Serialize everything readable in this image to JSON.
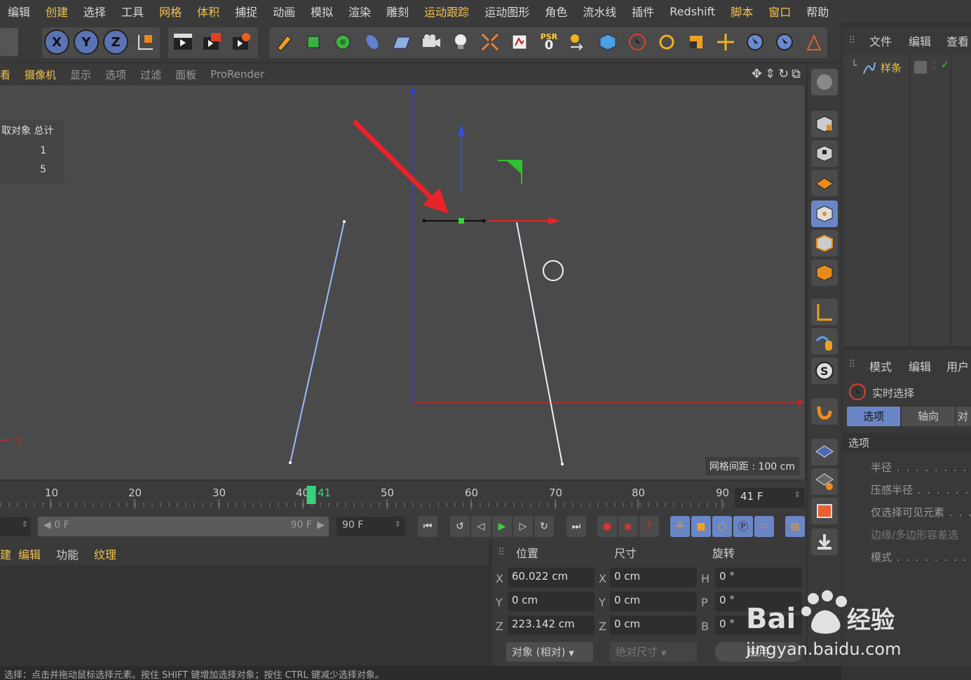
{
  "menubar": [
    "编辑",
    "创建",
    "选择",
    "工具",
    "网格",
    "体积",
    "捕捉",
    "动画",
    "模拟",
    "渲染",
    "雕刻",
    "运动跟踪",
    "运动图形",
    "角色",
    "流水线",
    "插件",
    "Redshift",
    "脚本",
    "窗口",
    "帮助"
  ],
  "toolbar": {
    "psr_label": "PSR",
    "psr_value": "0"
  },
  "viewport_menu": [
    "看",
    "摄像机",
    "显示",
    "选项",
    "过滤",
    "面板",
    "ProRender"
  ],
  "stats": {
    "header": "取对象 总计",
    "values": [
      "1",
      "5"
    ]
  },
  "viewport": {
    "axis_x_label": "X",
    "grid_info": "网格间距 : 100 cm"
  },
  "object_manager": {
    "tabs": [
      "文件",
      "编辑",
      "查看"
    ],
    "object_name": "样条"
  },
  "attribute_manager": {
    "tabs": [
      "模式",
      "编辑",
      "用户"
    ],
    "tool_name": "实时选择",
    "subtabs": [
      "选项",
      "轴向",
      "对"
    ],
    "section": "选项",
    "fields": [
      "半径",
      "压感半径",
      "仅选择可见元素",
      "边缘/多边形容差选",
      "模式"
    ]
  },
  "timeline": {
    "ticks": [
      "10",
      "20",
      "30",
      "40",
      "50",
      "60",
      "70",
      "80",
      "90"
    ],
    "current_marker": "41",
    "current_frame": "41 F",
    "current_frame_value": 41
  },
  "transport": {
    "start_field": "0 F",
    "range_start": "0 F",
    "range_end": "90 F",
    "end_field": "90 F"
  },
  "material_manager": {
    "menu": [
      "建",
      "编辑",
      "功能",
      "纹理"
    ]
  },
  "coordinates": {
    "headers": [
      "位置",
      "尺寸",
      "旋转"
    ],
    "rows": [
      {
        "pos_label": "X",
        "pos": "60.022 cm",
        "size_label": "X",
        "size": "0 cm",
        "rot_label": "H",
        "rot": "0 °"
      },
      {
        "pos_label": "Y",
        "pos": "0 cm",
        "size_label": "Y",
        "size": "0 cm",
        "rot_label": "P",
        "rot": "0 °"
      },
      {
        "pos_label": "Z",
        "pos": "223.142 cm",
        "size_label": "Z",
        "size": "0 cm",
        "rot_label": "B",
        "rot": "0 °"
      }
    ],
    "mode_dropdown": "对象 (相对)",
    "size_dropdown": "绝对尺寸",
    "apply_button": "应用"
  },
  "statusbar": "选择：点击并拖动鼠标选择元素。按住 SHIFT 键增加选择对象；按住 CTRL 键减少选择对象。",
  "watermark": {
    "brand": "Bai",
    "brand_cn": "经验",
    "url": "jingyan.baidu.com"
  },
  "colors": {
    "accent": "#f2c14e",
    "axis_red": "#e03030",
    "axis_blue": "#3050e0",
    "axis_green": "#30c030",
    "arrow": "#e8242a"
  }
}
